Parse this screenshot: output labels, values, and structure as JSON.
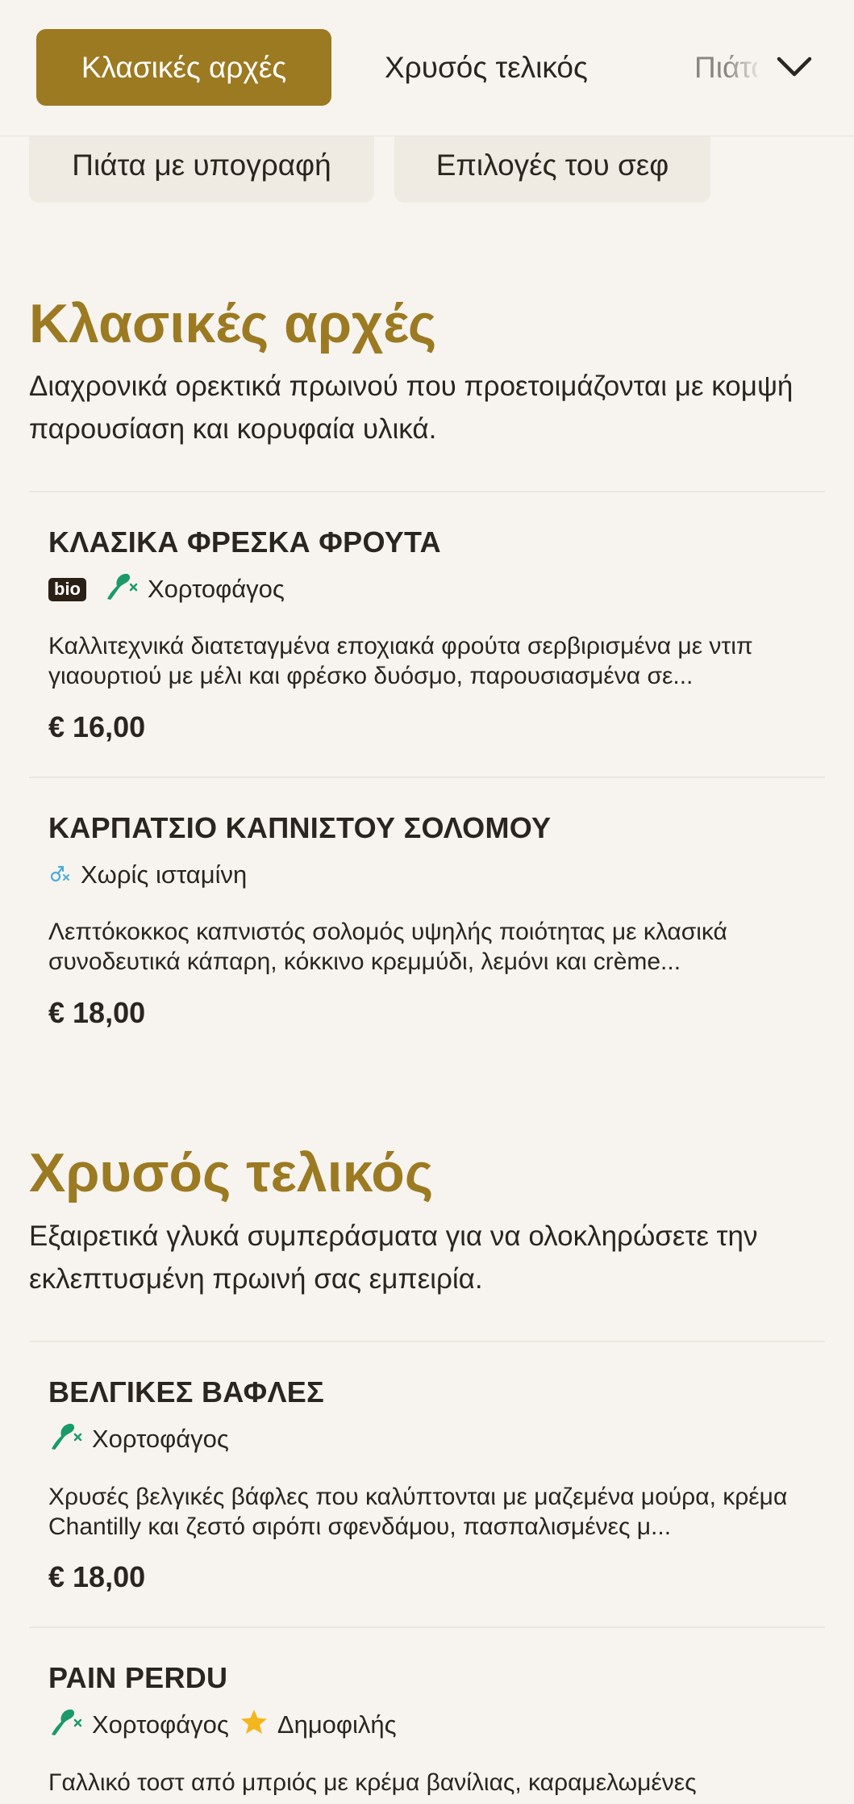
{
  "category_bar": {
    "active_tab": "Κλασικές αρχές",
    "tab_2": "Χρυσός τελικός",
    "tab_3": "Πιάτα με υπογραφή",
    "chips": [
      "Πιάτα με υπογραφή",
      "Επιλογές του σεφ"
    ]
  },
  "colors": {
    "accent": "#9b7a22",
    "background": "#f7f4ef",
    "chip_background": "#efebe2",
    "vegetarian_icon": "#1a9a6a",
    "star": "#f3b61c"
  },
  "sections": [
    {
      "title": "Κλασικές αρχές",
      "description": "Διαχρονικά ορεκτικά πρωινού που προετοιμάζονται με κομψή παρουσίαση και κορυφαία υλικά.",
      "items": [
        {
          "name": "ΚΛΑΣΙΚΑ ΦΡΕΣΚΑ ΦΡΟΥΤΑ",
          "badge": "bio",
          "tags": [
            {
              "icon": "vegetarian-icon",
              "label": "Χορτοφάγος"
            }
          ],
          "description": "Καλλιτεχνικά διατεταγμένα εποχιακά φρούτα σερβιρισμένα με ντιπ γιαουρτιού με μέλι και φρέσκο δυόσμο, παρουσιασμένα σε...",
          "price": "€ 16,00"
        },
        {
          "name": "ΚΑΡΠΑΤΣΙΟ ΚΑΠΝΙΣΤΟΥ ΣΟΛΟΜΟΥ",
          "tags": [
            {
              "icon": "histamine-free-icon",
              "label": "Χωρίς ισταμίνη"
            }
          ],
          "description": "Λεπτόκοκκος καπνιστός σολομός υψηλής ποιότητας με κλασικά συνοδευτικά κάπαρη, κόκκινο κρεμμύδι, λεμόνι και crème...",
          "price": "€ 18,00"
        }
      ]
    },
    {
      "title": "Χρυσός τελικός",
      "description": "Εξαιρετικά γλυκά συμπεράσματα για να ολοκληρώσετε την εκλεπτυσμένη πρωινή σας εμπειρία.",
      "items": [
        {
          "name": "ΒΕΛΓΙΚΕΣ ΒΑΦΛΕΣ",
          "tags": [
            {
              "icon": "vegetarian-icon",
              "label": "Χορτοφάγος"
            }
          ],
          "description": "Χρυσές βελγικές βάφλες που καλύπτονται με μαζεμένα μούρα, κρέμα Chantilly και ζεστό σιρόπι σφενδάμου, πασπαλισμένες μ...",
          "price": "€ 18,00"
        },
        {
          "name": "PAIN PERDU",
          "tags": [
            {
              "icon": "vegetarian-icon",
              "label": "Χορτοφάγος"
            },
            {
              "icon": "star-icon",
              "label": "Δημοφιλής"
            }
          ],
          "description": "Γαλλικό τοστ από μπριός με κρέμα βανίλιας, καραμελωμένες"
        }
      ]
    }
  ]
}
